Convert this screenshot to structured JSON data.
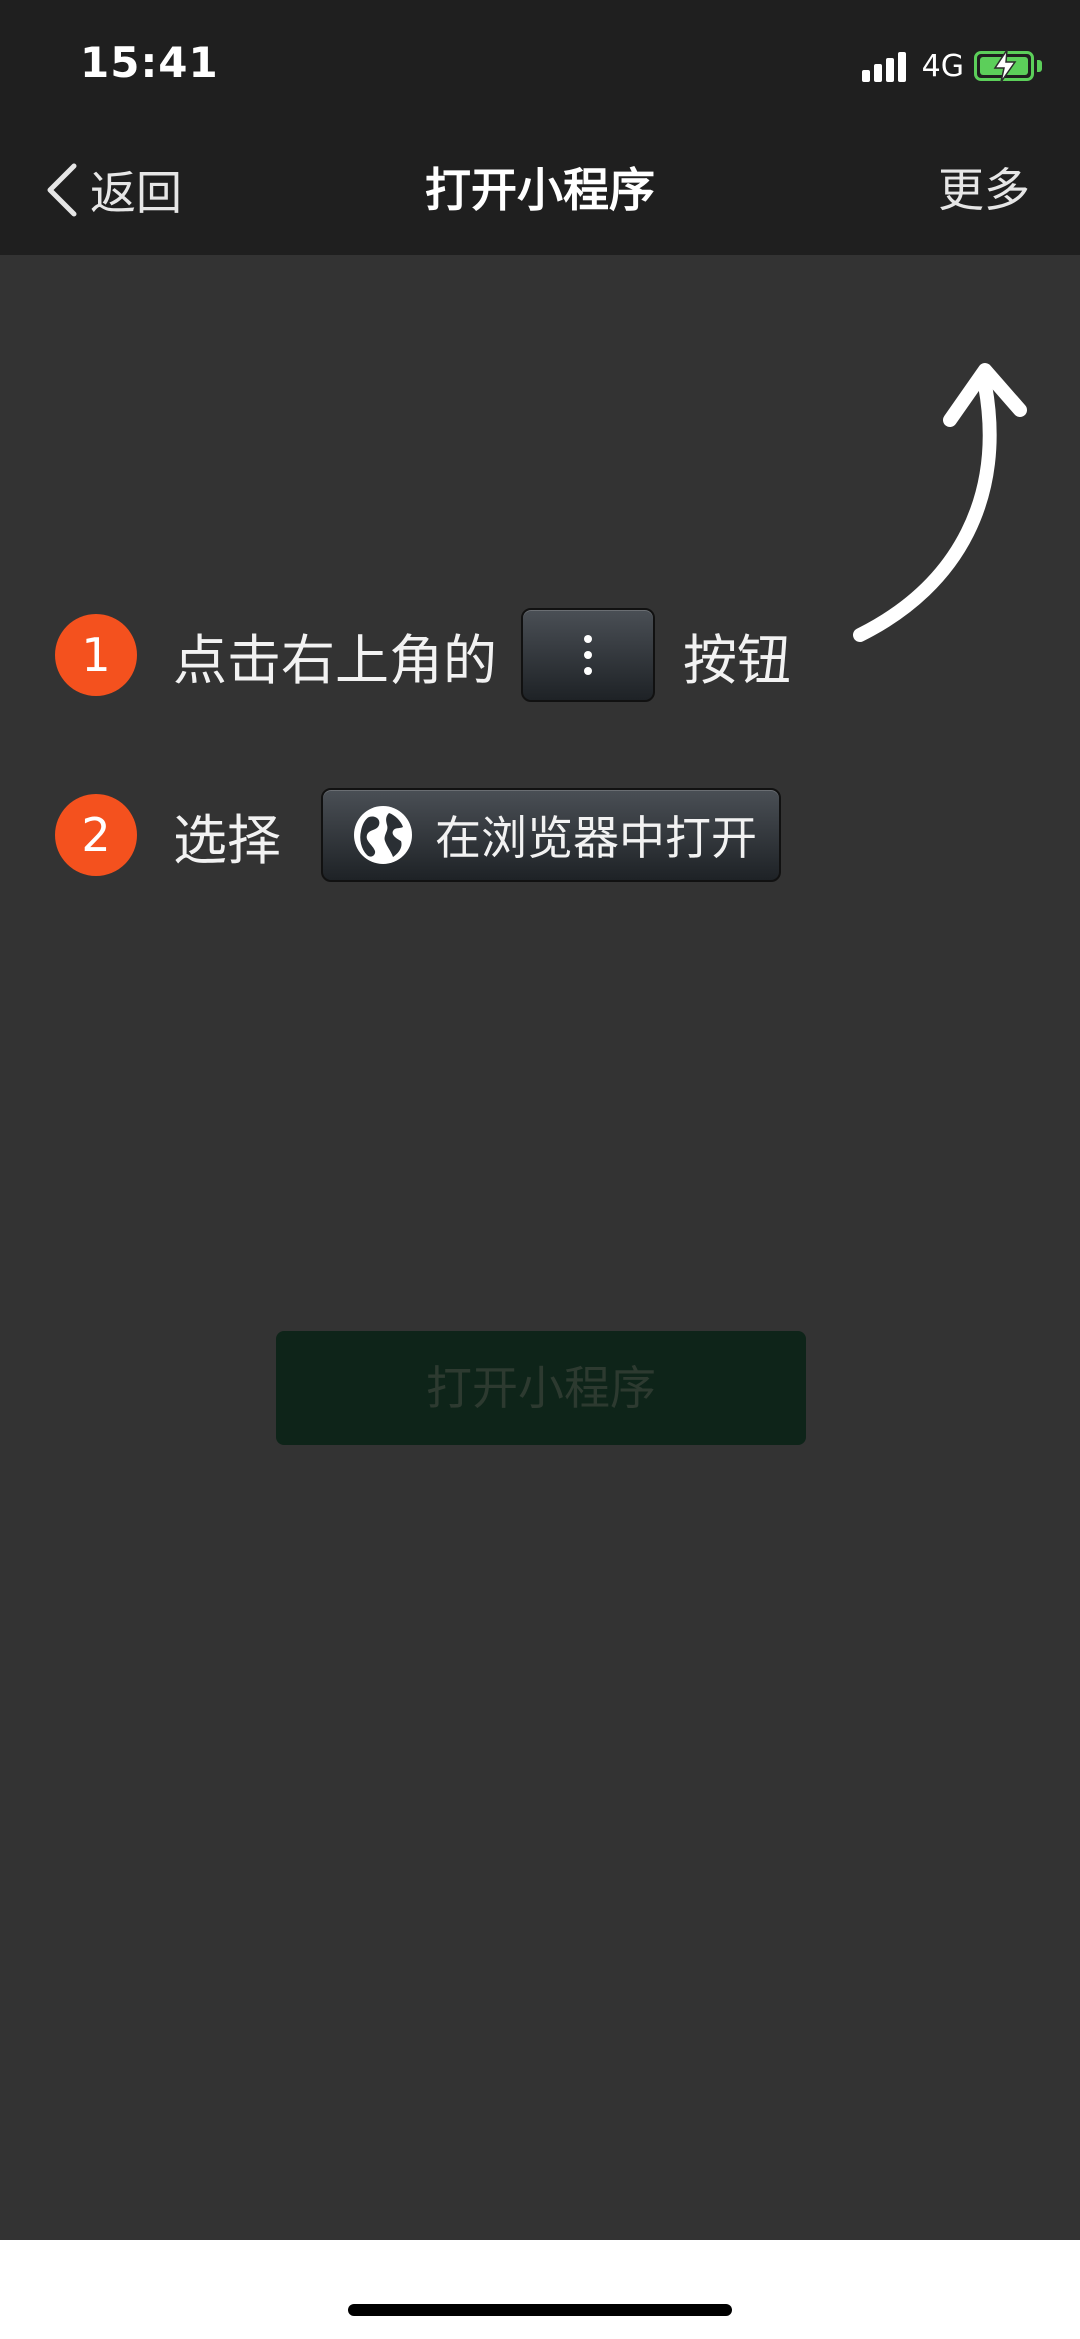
{
  "status_bar": {
    "time": "15:41",
    "network": "4G",
    "battery_state": "charging",
    "signal_bars": 4,
    "battery_color": "#5ccf5a"
  },
  "nav": {
    "back_label": "返回",
    "title": "打开小程序",
    "more_label": "更多"
  },
  "steps": [
    {
      "number": "1",
      "text": "点击右上角的",
      "button_icon": "more-dots-icon",
      "after_text": "按钮"
    },
    {
      "number": "2",
      "text": "选择",
      "button_icon": "globe-icon",
      "button_label": "在浏览器中打开"
    }
  ],
  "open_button": {
    "label": "打开小程序"
  },
  "colors": {
    "nav_bg": "#1f1f1f",
    "content_bg": "#333333",
    "step_badge": "#f4511e",
    "open_button_bg": "#0e2419"
  }
}
